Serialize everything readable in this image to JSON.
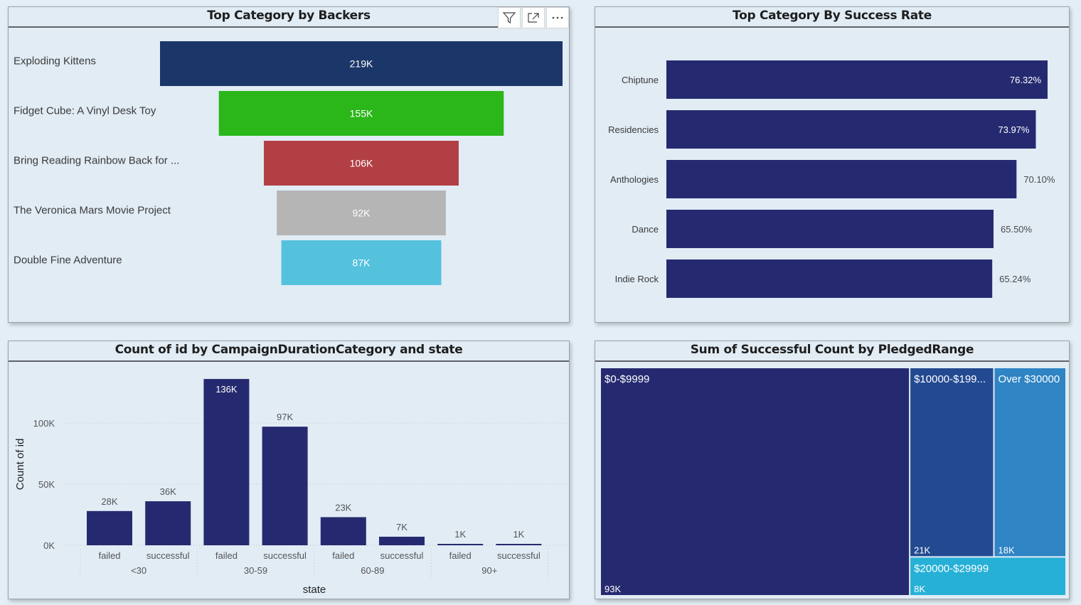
{
  "funnel": {
    "title": "Top Category by Backers",
    "toolbar": {
      "filter_icon": "filter-icon",
      "focus_icon": "focus-mode-icon",
      "more_icon": "more-options-icon"
    },
    "chart_data": {
      "type": "funnel",
      "categories": [
        "Exploding Kittens",
        "Fidget Cube: A Vinyl Desk Toy",
        "Bring Reading Rainbow Back for ...",
        "The Veronica Mars Movie Project",
        "Double Fine Adventure"
      ],
      "values": [
        219000,
        155000,
        106000,
        92000,
        87000
      ],
      "labels": [
        "219K",
        "155K",
        "106K",
        "92K",
        "87K"
      ],
      "colors": [
        "#1b3669",
        "#2bb61a",
        "#b13f44",
        "#b5b5b5",
        "#54c1dd"
      ]
    }
  },
  "success": {
    "title": "Top Category By Success Rate",
    "chart_data": {
      "type": "bar",
      "orientation": "horizontal",
      "categories": [
        "Chiptune",
        "Residencies",
        "Anthologies",
        "Dance",
        "Indie Rock"
      ],
      "values": [
        76.32,
        73.97,
        70.1,
        65.5,
        65.24
      ],
      "labels": [
        "76.32%",
        "73.97%",
        "70.10%",
        "65.50%",
        "65.24%"
      ],
      "color": "#252a70"
    }
  },
  "duration": {
    "title": "Count of id by CampaignDurationCategory and state",
    "chart_data": {
      "type": "bar",
      "xlabel": "state",
      "ylabel": "Count of id",
      "ylim": [
        0,
        140000
      ],
      "yticks": [
        0,
        50000,
        100000
      ],
      "ytick_labels": [
        "0K",
        "50K",
        "100K"
      ],
      "groups": [
        "<30",
        "30-59",
        "60-89",
        "90+"
      ],
      "categories": [
        "failed",
        "successful",
        "failed",
        "successful",
        "failed",
        "successful",
        "failed",
        "successful"
      ],
      "values": [
        28000,
        36000,
        136000,
        97000,
        23000,
        7000,
        1000,
        1000
      ],
      "labels": [
        "28K",
        "36K",
        "136K",
        "97K",
        "23K",
        "7K",
        "1K",
        "1K"
      ],
      "color": "#252a70"
    }
  },
  "treemap": {
    "title": "Sum of Successful Count by PledgedRange",
    "chart_data": {
      "type": "treemap",
      "categories": [
        "$0-$9999",
        "$10000-$199...",
        "Over $30000",
        "$20000-$29999"
      ],
      "values": [
        93000,
        21000,
        18000,
        8000
      ],
      "labels": [
        "93K",
        "21K",
        "18K",
        "8K"
      ],
      "colors": [
        "#252a70",
        "#234a91",
        "#2f84c4",
        "#27b0d6"
      ]
    }
  }
}
